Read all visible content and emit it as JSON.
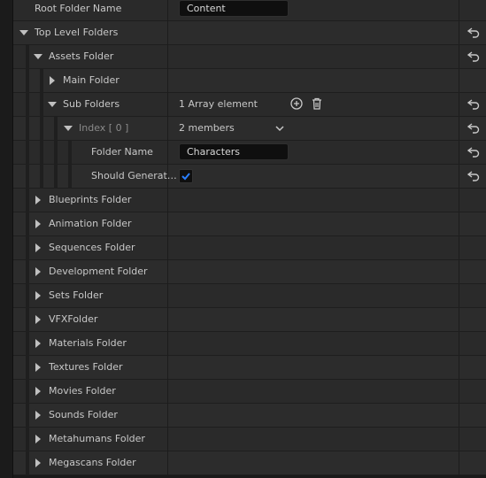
{
  "rows": {
    "root_folder_name": {
      "label": "Root Folder Name",
      "value": "Content"
    },
    "top_level_folders": {
      "label": "Top Level Folders"
    },
    "assets_folder": {
      "label": "Assets Folder"
    },
    "main_folder": {
      "label": "Main Folder"
    },
    "sub_folders": {
      "label": "Sub Folders",
      "value": "1 Array element"
    },
    "index0": {
      "label": "Index [ 0 ]",
      "value": "2 members"
    },
    "folder_name": {
      "label": "Folder Name",
      "value": "Characters"
    },
    "should_generate": {
      "label": "Should Generat…",
      "checked": true
    },
    "collapsed": [
      "Blueprints Folder",
      "Animation Folder",
      "Sequences Folder",
      "Development Folder",
      "Sets Folder",
      "VFXFolder",
      "Materials Folder",
      "Textures Folder",
      "Movies Folder",
      "Sounds Folder",
      "Metahumans Folder",
      "Megascans Folder"
    ]
  },
  "icons": {
    "reset": "reset-arrow-icon",
    "add": "add-circle-icon",
    "delete": "trash-icon",
    "expand": "chevron-down-icon"
  },
  "colors": {
    "checkbox_accent": "#2a7fff"
  }
}
